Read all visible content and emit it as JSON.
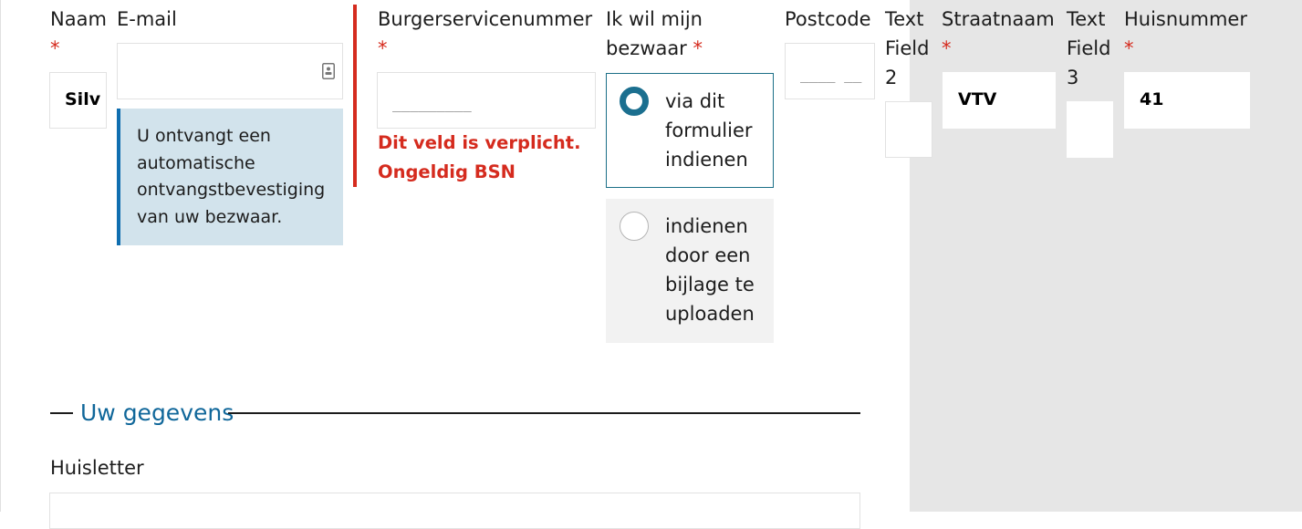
{
  "form": {
    "required_mark": "*",
    "naam": {
      "label": "Naam",
      "value": "Silv"
    },
    "email": {
      "label": "E-mail",
      "value": "",
      "icon": "contact-card-icon",
      "info": "U ontvangt een automatische ontvangstbevestiging van uw bezwaar."
    },
    "bsn": {
      "label": "Burgerservicenummer",
      "mask": "_________",
      "errors": [
        "Dit veld is verplicht.",
        "Ongeldig BSN"
      ]
    },
    "bezwaar": {
      "label_lines": [
        "Ik wil mijn",
        "bezwaar"
      ],
      "options": [
        {
          "lines": [
            "via dit",
            "formulier",
            "indienen"
          ],
          "selected": true
        },
        {
          "lines": [
            "indienen",
            "door een",
            "bijlage te",
            "uploaden"
          ],
          "selected": false
        }
      ]
    },
    "postcode": {
      "label": "Postcode",
      "mask": "____ __"
    },
    "text_field_2": {
      "label_lines": [
        "Text",
        "Field",
        "2"
      ],
      "value": ""
    },
    "straatnaam": {
      "label": "Straatnaam",
      "value": "VTV"
    },
    "text_field_3": {
      "label_lines": [
        "Text",
        "Field",
        "3"
      ],
      "value": ""
    },
    "huisnummer": {
      "label": "Huisnummer",
      "value": "41"
    }
  },
  "section": {
    "legend": "Uw gegevens"
  },
  "huisletter": {
    "label": "Huisletter",
    "value": ""
  },
  "colors": {
    "accent": "#10679a",
    "error": "#d52b1e",
    "info_bg": "#d2e3ec",
    "info_border": "#0f6eb0",
    "panel_bg": "#e6e6e6"
  }
}
